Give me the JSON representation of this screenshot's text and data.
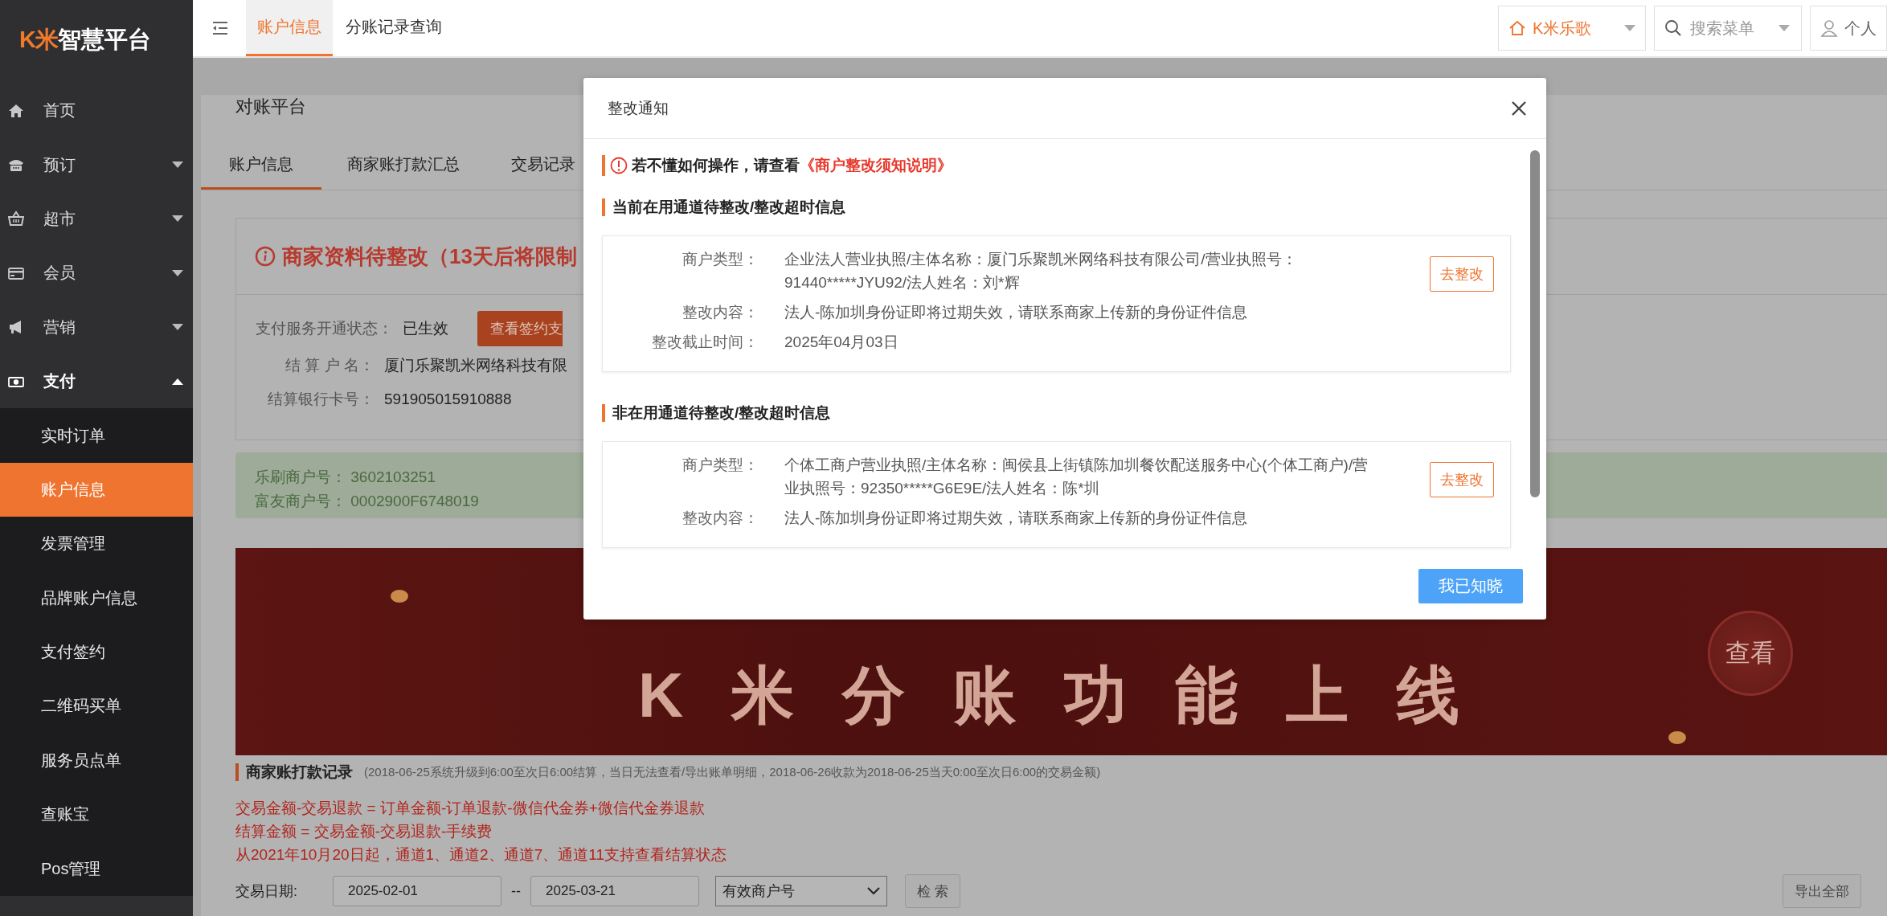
{
  "sidebar": {
    "logo": {
      "mark": "K米",
      "name": "智慧平台"
    },
    "items": [
      {
        "label": "首页",
        "kind": "link"
      },
      {
        "label": "预订",
        "kind": "group",
        "expanded": false
      },
      {
        "label": "超市",
        "kind": "group",
        "expanded": false
      },
      {
        "label": "会员",
        "kind": "group",
        "expanded": false
      },
      {
        "label": "营销",
        "kind": "group",
        "expanded": false
      },
      {
        "label": "支付",
        "kind": "group",
        "expanded": true,
        "children": [
          {
            "label": "实时订单",
            "selected": false
          },
          {
            "label": "账户信息",
            "selected": true
          },
          {
            "label": "发票管理",
            "selected": false
          },
          {
            "label": "品牌账户信息",
            "selected": false
          },
          {
            "label": "支付签约",
            "selected": false
          },
          {
            "label": "二维码买单",
            "selected": false
          },
          {
            "label": "服务员点单",
            "selected": false
          },
          {
            "label": "查账宝",
            "selected": false
          },
          {
            "label": "Pos管理",
            "selected": false
          }
        ]
      }
    ]
  },
  "topbar": {
    "tabs": [
      {
        "label": "账户信息",
        "selected": true
      },
      {
        "label": "分账记录查询",
        "selected": false
      }
    ],
    "store_select": "K米乐歌",
    "menu_search": {
      "placeholder": "搜索菜单"
    },
    "user_menu": "个人"
  },
  "page": {
    "title": "对账平台",
    "tabs": [
      {
        "label": "账户信息",
        "selected": true
      },
      {
        "label": "商家账打款汇总",
        "selected": false
      },
      {
        "label": "交易记录",
        "selected": false
      }
    ],
    "alert": {
      "title": "商家资料待整改（13天后将限制",
      "rows": [
        {
          "label": "支付服务开通状态：",
          "value": "已生效",
          "action": "查看签约支"
        },
        {
          "label": "结 算 户 名：",
          "value": "厦门乐聚凯米网络科技有限"
        },
        {
          "label": "结算银行卡号：",
          "value": "591905015910888"
        }
      ]
    },
    "merchant_ids": [
      {
        "label": "乐刷商户号：",
        "value": "3602103251"
      },
      {
        "label": "富友商户号：",
        "value": "0002900F6748019"
      }
    ],
    "banner": {
      "headline": "K米分账功能上线",
      "button": "查看"
    },
    "payout_records": {
      "title": "商家账打款记录",
      "note": "(2018-06-25系统升级到6:00至次日6:00结算，当日无法查看/导出账单明细，2018-06-26收款为2018-06-25当天0:00至次日6:00的交易金额)",
      "formulas": [
        "交易金额-交易退款 = 订单金额-订单退款-微信代金券+微信代金券退款",
        "结算金额 = 交易金额-交易退款-手续费",
        "从2021年10月20日起，通道1、通道2、通道7、通道11支持查看结算状态"
      ],
      "filters": {
        "date_label": "交易日期:",
        "start": "2025-02-01",
        "separator": "--",
        "end": "2025-03-21",
        "merchant_select": "有效商户号",
        "search_button": "检 索",
        "export_button": "导出全部"
      }
    }
  },
  "modal": {
    "title": "整改通知",
    "notice": {
      "text": "若不懂如何操作，请查看",
      "link": "《商户整改须知说明》"
    },
    "sections": [
      {
        "heading": "当前在用通道待整改/整改超时信息",
        "action": "去整改",
        "rows": [
          {
            "label": "商户类型：",
            "value": "企业法人营业执照/主体名称：厦门乐聚凯米网络科技有限公司/营业执照号：91440*****JYU92/法人姓名：刘*辉"
          },
          {
            "label": "整改内容：",
            "value": "法人-陈加圳身份证即将过期失效，请联系商家上传新的身份证件信息"
          },
          {
            "label": "整改截止时间：",
            "value": "2025年04月03日"
          }
        ]
      },
      {
        "heading": "非在用通道待整改/整改超时信息",
        "action": "去整改",
        "rows": [
          {
            "label": "商户类型：",
            "value": "个体工商户营业执照/主体名称：闽侯县上街镇陈加圳餐饮配送服务中心(个体工商户)/营业执照号：92350*****G6E9E/法人姓名：陈*圳"
          },
          {
            "label": "整改内容：",
            "value": "法人-陈加圳身份证即将过期失效，请联系商家上传新的身份证件信息"
          }
        ]
      }
    ],
    "confirm_button": "我已知晓"
  }
}
